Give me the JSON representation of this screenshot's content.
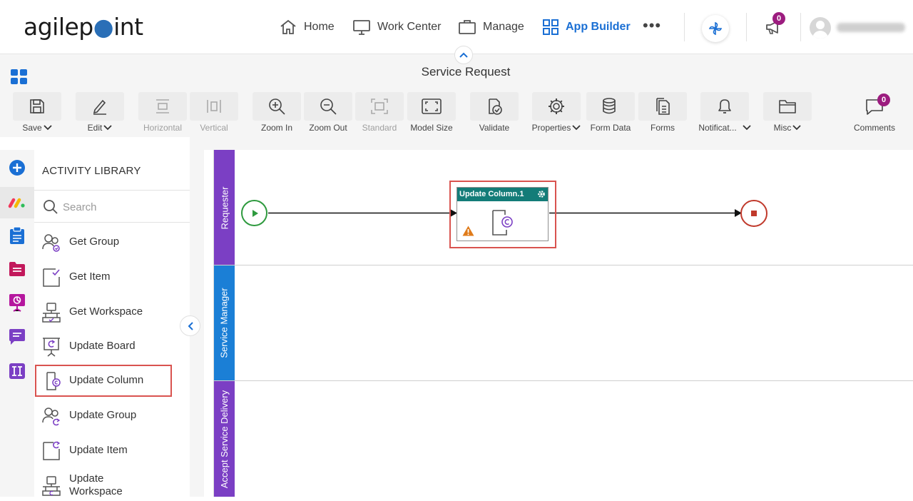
{
  "brand": {
    "logo_text_a": "agilep",
    "logo_text_b": "int"
  },
  "nav": {
    "home": "Home",
    "work_center": "Work Center",
    "manage": "Manage",
    "app_builder": "App Builder",
    "more": "•••",
    "notification_count": "0",
    "username": "username"
  },
  "page": {
    "title": "Service Request"
  },
  "toolbar": {
    "save": "Save",
    "edit": "Edit",
    "horizontal": "Horizontal",
    "vertical": "Vertical",
    "zoom_in": "Zoom In",
    "zoom_out": "Zoom Out",
    "standard": "Standard",
    "model_size": "Model Size",
    "validate": "Validate",
    "properties": "Properties",
    "form_data": "Form Data",
    "forms": "Forms",
    "notifications": "Notificat...",
    "misc": "Misc",
    "comments": "Comments",
    "comments_count": "0"
  },
  "library": {
    "title": "ACTIVITY LIBRARY",
    "search_placeholder": "Search",
    "items": [
      {
        "label": "Get Group",
        "icon": "get-group-icon"
      },
      {
        "label": "Get Item",
        "icon": "get-item-icon"
      },
      {
        "label": "Get Workspace",
        "icon": "get-workspace-icon"
      },
      {
        "label": "Update Board",
        "icon": "update-board-icon"
      },
      {
        "label": "Update Column",
        "icon": "update-column-icon"
      },
      {
        "label": "Update Group",
        "icon": "update-group-icon"
      },
      {
        "label": "Update Item",
        "icon": "update-item-icon"
      },
      {
        "label": "Update Workspace",
        "icon": "update-workspace-icon"
      }
    ]
  },
  "lanes": [
    {
      "label": "Requester",
      "color": "#7b3fc4"
    },
    {
      "label": "Service Manager",
      "color": "#1b7fd6"
    },
    {
      "label": "Accept Service Delivery",
      "color": "#7b3fc4"
    }
  ],
  "process": {
    "activity_title": "Update Column.1",
    "activity_status": "warning-icon"
  },
  "colors": {
    "accent": "#1a6fd4",
    "activity_header": "#137c78",
    "highlight": "#d9534f",
    "start_event": "#2e9a3e",
    "end_event": "#c0392b",
    "badge": "#9c1c7f"
  }
}
